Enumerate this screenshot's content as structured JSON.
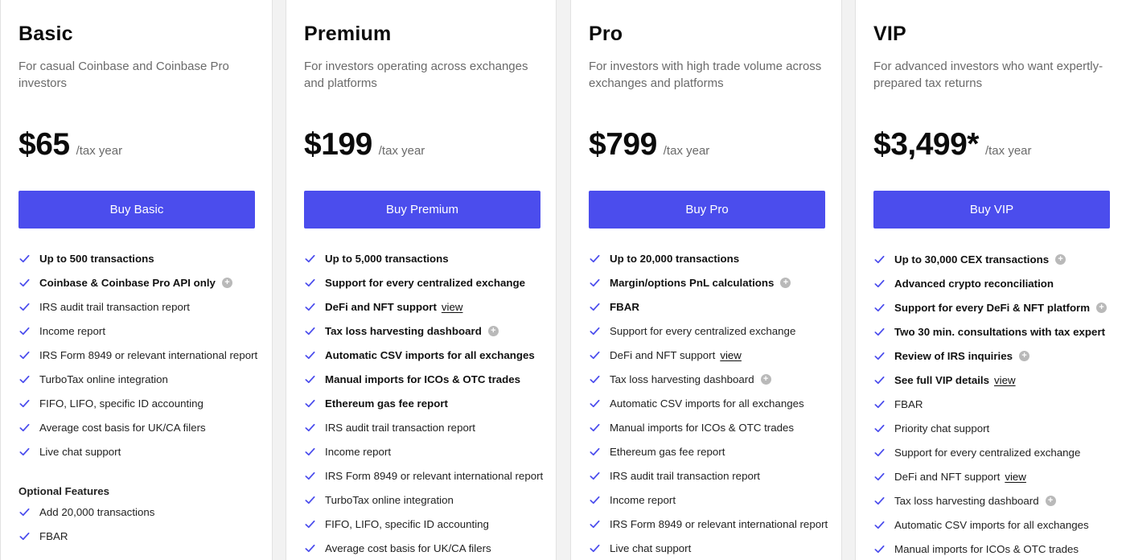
{
  "plans": {
    "basic": {
      "name": "Basic",
      "description": "For casual Coinbase and Coinbase Pro investors",
      "price": "$65",
      "period": "/tax year",
      "button": "Buy Basic",
      "features": [
        {
          "text": "Up to 500 transactions",
          "bold": true
        },
        {
          "text": "Coinbase & Coinbase Pro API only",
          "bold": true,
          "info": true
        },
        {
          "text": "IRS audit trail transaction report"
        },
        {
          "text": "Income report"
        },
        {
          "text": "IRS Form 8949 or relevant international report"
        },
        {
          "text": "TurboTax online integration"
        },
        {
          "text": "FIFO, LIFO, specific ID accounting"
        },
        {
          "text": "Average cost basis for UK/CA filers"
        },
        {
          "text": "Live chat support"
        }
      ],
      "optional_heading": "Optional Features",
      "optional_features": [
        {
          "text": "Add 20,000 transactions"
        },
        {
          "text": "FBAR"
        }
      ]
    },
    "premium": {
      "name": "Premium",
      "description": "For investors operating across exchanges and platforms",
      "price": "$199",
      "period": "/tax year",
      "button": "Buy Premium",
      "features": [
        {
          "text": "Up to 5,000 transactions",
          "bold": true
        },
        {
          "text": "Support for every centralized exchange",
          "bold": true
        },
        {
          "text": "DeFi and NFT support",
          "bold": true,
          "link": "view"
        },
        {
          "text": "Tax loss harvesting dashboard",
          "bold": true,
          "info": true
        },
        {
          "text": "Automatic CSV imports for all exchanges",
          "bold": true
        },
        {
          "text": "Manual imports for ICOs & OTC trades",
          "bold": true
        },
        {
          "text": "Ethereum gas fee report",
          "bold": true
        },
        {
          "text": "IRS audit trail transaction report"
        },
        {
          "text": "Income report"
        },
        {
          "text": "IRS Form 8949 or relevant international report"
        },
        {
          "text": "TurboTax online integration"
        },
        {
          "text": "FIFO, LIFO, specific ID accounting"
        },
        {
          "text": "Average cost basis for UK/CA filers"
        }
      ]
    },
    "pro": {
      "name": "Pro",
      "description": "For investors with high trade volume across exchanges and platforms",
      "price": "$799",
      "period": "/tax year",
      "button": "Buy Pro",
      "features": [
        {
          "text": "Up to 20,000 transactions",
          "bold": true
        },
        {
          "text": "Margin/options PnL calculations",
          "bold": true,
          "info": true
        },
        {
          "text": "FBAR",
          "bold": true
        },
        {
          "text": "Support for every centralized exchange"
        },
        {
          "text": "DeFi and NFT support",
          "link": "view"
        },
        {
          "text": "Tax loss harvesting dashboard",
          "info": true
        },
        {
          "text": "Automatic CSV imports for all exchanges"
        },
        {
          "text": "Manual imports for ICOs & OTC trades"
        },
        {
          "text": "Ethereum gas fee report"
        },
        {
          "text": "IRS audit trail transaction report"
        },
        {
          "text": "Income report"
        },
        {
          "text": "IRS Form 8949 or relevant international report"
        },
        {
          "text": "Live chat support"
        }
      ]
    },
    "vip": {
      "name": "VIP",
      "description": "For advanced investors who want expertly-prepared tax returns",
      "price": "$3,499*",
      "period": "/tax year",
      "button": "Buy VIP",
      "features": [
        {
          "text": "Up to 30,000 CEX transactions",
          "bold": true,
          "info": true
        },
        {
          "text": "Advanced crypto reconciliation",
          "bold": true
        },
        {
          "text": "Support for every DeFi & NFT platform",
          "bold": true,
          "info": true
        },
        {
          "text": "Two 30 min. consultations with tax expert",
          "bold": true
        },
        {
          "text": "Review of IRS inquiries",
          "bold": true,
          "info": true
        },
        {
          "text": "See full VIP details",
          "bold": true,
          "link": "view"
        },
        {
          "text": "FBAR"
        },
        {
          "text": "Priority chat support"
        },
        {
          "text": "Support for every centralized exchange"
        },
        {
          "text": "DeFi and NFT support",
          "link": "view"
        },
        {
          "text": "Tax loss harvesting dashboard",
          "info": true
        },
        {
          "text": "Automatic CSV imports for all exchanges"
        },
        {
          "text": "Manual imports for ICOs & OTC trades"
        }
      ]
    }
  },
  "colors": {
    "accent": "#4b4ded",
    "check": "#4b4ded",
    "muted_text": "#6a6a6a",
    "info_icon": "#b9b9b9"
  },
  "icons": {
    "feature": "check-icon",
    "info": "info-icon"
  }
}
